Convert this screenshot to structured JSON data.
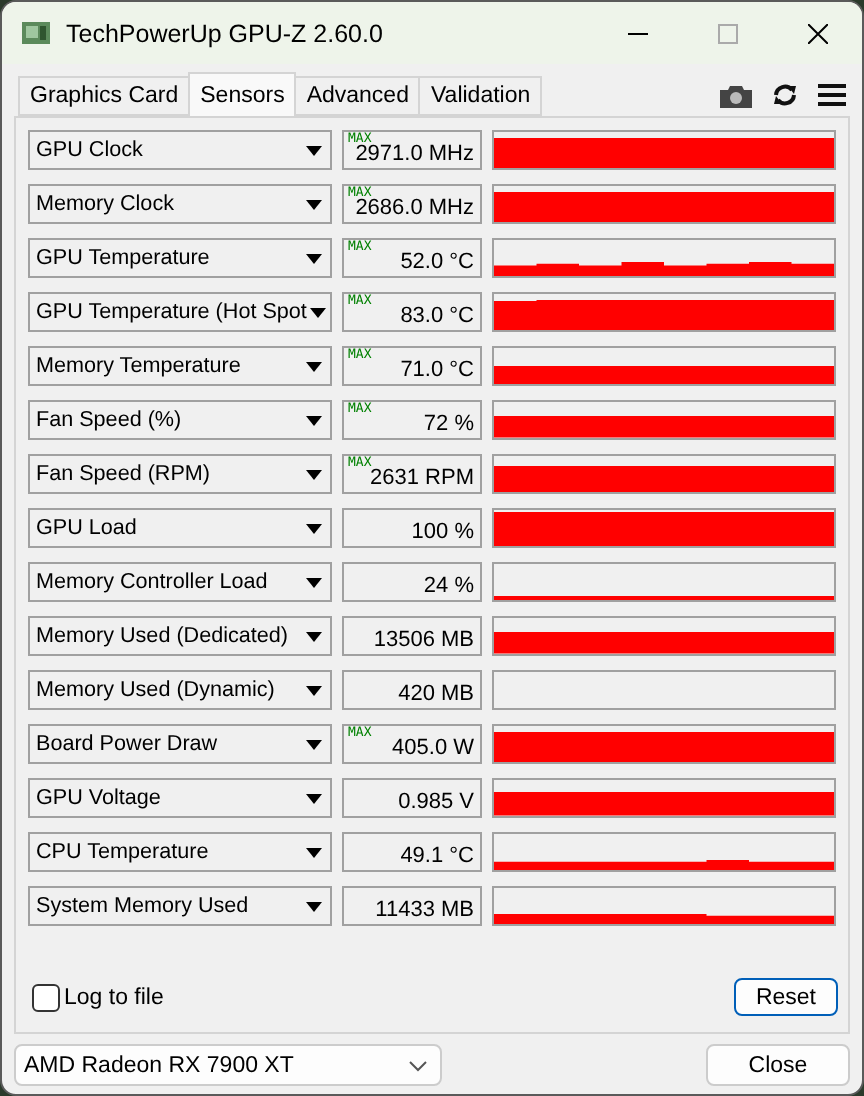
{
  "window": {
    "title": "TechPowerUp GPU-Z 2.60.0"
  },
  "tabs": [
    {
      "label": "Graphics Card",
      "selected": false
    },
    {
      "label": "Sensors",
      "selected": true
    },
    {
      "label": "Advanced",
      "selected": false
    },
    {
      "label": "Validation",
      "selected": false
    }
  ],
  "sensors": [
    {
      "name": "GPU Clock",
      "value": "2971.0 MHz",
      "max_marker": "MAX"
    },
    {
      "name": "Memory Clock",
      "value": "2686.0 MHz",
      "max_marker": "MAX"
    },
    {
      "name": "GPU Temperature",
      "value": "52.0 °C",
      "max_marker": "MAX"
    },
    {
      "name": "GPU Temperature (Hot Spot",
      "value": "83.0 °C",
      "max_marker": "MAX"
    },
    {
      "name": "Memory Temperature",
      "value": "71.0 °C",
      "max_marker": "MAX"
    },
    {
      "name": "Fan Speed (%)",
      "value": "72 %",
      "max_marker": "MAX"
    },
    {
      "name": "Fan Speed (RPM)",
      "value": "2631 RPM",
      "max_marker": "MAX"
    },
    {
      "name": "GPU Load",
      "value": "100 %"
    },
    {
      "name": "Memory Controller Load",
      "value": "24 %"
    },
    {
      "name": "Memory Used (Dedicated)",
      "value": "13506 MB"
    },
    {
      "name": "Memory Used (Dynamic)",
      "value": "420 MB"
    },
    {
      "name": "Board Power Draw",
      "value": "405.0 W",
      "max_marker": "MAX"
    },
    {
      "name": "GPU Voltage",
      "value": "0.985 V"
    },
    {
      "name": "CPU Temperature",
      "value": "49.1 °C"
    },
    {
      "name": "System Memory Used",
      "value": "11433 MB"
    }
  ],
  "log_to_file": {
    "label": "Log to file",
    "checked": false
  },
  "reset_button": "Reset",
  "device_select": {
    "value": "AMD Radeon RX 7900 XT"
  },
  "close_button": "Close"
}
